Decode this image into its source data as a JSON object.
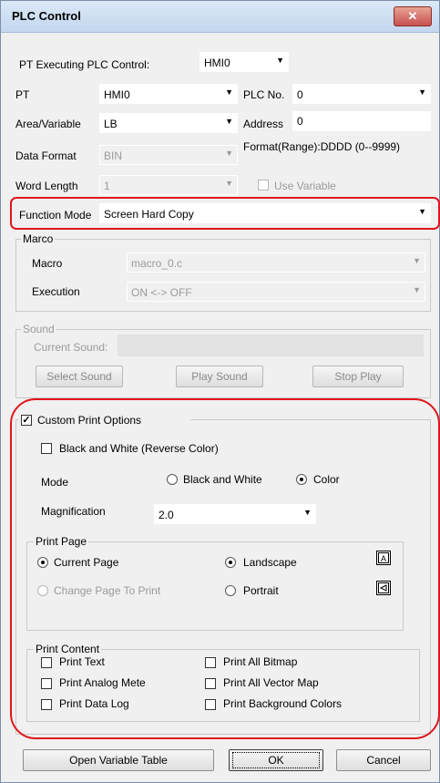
{
  "window": {
    "title": "PLC Control",
    "close_glyph": "✕"
  },
  "pt_exec": {
    "label": "PT Executing PLC Control:",
    "value": "HMI0"
  },
  "pt": {
    "label": "PT",
    "value": "HMI0"
  },
  "plc_no": {
    "label": "PLC No.",
    "value": "0"
  },
  "area": {
    "label": "Area/Variable",
    "value": "LB"
  },
  "address": {
    "label": "Address",
    "value": "0"
  },
  "data_format": {
    "label": "Data Format",
    "value": "BIN",
    "range": "Format(Range):DDDD (0--9999)"
  },
  "word_length": {
    "label": "Word Length",
    "value": "1",
    "use_variable": "Use Variable"
  },
  "function_mode": {
    "label": "Function Mode",
    "value": "Screen Hard Copy"
  },
  "macro_group": {
    "title": "Marco",
    "macro_label": "Macro",
    "macro_value": "macro_0.c",
    "execution_label": "Execution",
    "execution_value": "ON <-> OFF"
  },
  "sound_group": {
    "title": "Sound",
    "current_label": "Current Sound:",
    "select": "Select Sound",
    "play": "Play Sound",
    "stop": "Stop Play"
  },
  "custom": {
    "title": "Custom Print Options",
    "bw_reverse": "Black and White (Reverse Color)",
    "mode_label": "Mode",
    "mode_bw": "Black and White",
    "mode_color": "Color",
    "mag_label": "Magnification",
    "mag_value": "2.0"
  },
  "print_page": {
    "title": "Print Page",
    "current": "Current Page",
    "change": "Change Page To Print",
    "landscape": "Landscape",
    "portrait": "Portrait"
  },
  "print_content": {
    "title": "Print Content",
    "items": [
      "Print Text",
      "Print All Bitmap",
      "Print Analog Mete",
      "Print All Vector Map",
      "Print Data Log",
      "Print Background Colors"
    ]
  },
  "footer": {
    "open_table": "Open Variable Table",
    "ok": "OK",
    "cancel": "Cancel"
  },
  "colors": {
    "highlight": "#e0161b",
    "title_bg": "#c3d6ee",
    "close_bg": "#c75050"
  }
}
